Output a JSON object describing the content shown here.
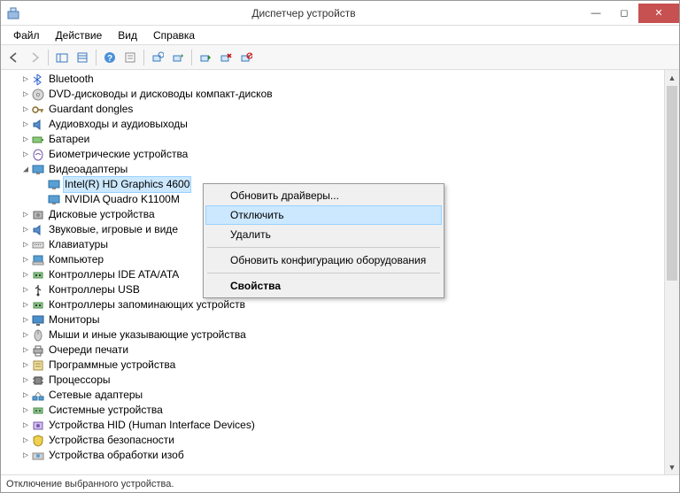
{
  "window": {
    "title": "Диспетчер устройств"
  },
  "menu": {
    "file": "Файл",
    "action": "Действие",
    "view": "Вид",
    "help": "Справка"
  },
  "tree": {
    "nodes": [
      {
        "label": "Bluetooth",
        "expander": "▷",
        "indent": 1,
        "icon": "bluetooth"
      },
      {
        "label": "DVD-дисководы и дисководы компакт-дисков",
        "expander": "▷",
        "indent": 1,
        "icon": "dvd"
      },
      {
        "label": "Guardant dongles",
        "expander": "▷",
        "indent": 1,
        "icon": "key"
      },
      {
        "label": "Аудиовходы и аудиовыходы",
        "expander": "▷",
        "indent": 1,
        "icon": "audio"
      },
      {
        "label": "Батареи",
        "expander": "▷",
        "indent": 1,
        "icon": "battery"
      },
      {
        "label": "Биометрические устройства",
        "expander": "▷",
        "indent": 1,
        "icon": "biometric"
      },
      {
        "label": "Видеоадаптеры",
        "expander": "◢",
        "indent": 1,
        "icon": "display"
      },
      {
        "label": "Intel(R) HD Graphics 4600",
        "expander": "",
        "indent": 2,
        "icon": "display",
        "selected": true
      },
      {
        "label": "NVIDIA Quadro K1100M",
        "expander": "",
        "indent": 2,
        "icon": "display"
      },
      {
        "label": "Дисковые устройства",
        "expander": "▷",
        "indent": 1,
        "icon": "disk"
      },
      {
        "label": "Звуковые, игровые и виде",
        "expander": "▷",
        "indent": 1,
        "icon": "audio"
      },
      {
        "label": "Клавиатуры",
        "expander": "▷",
        "indent": 1,
        "icon": "keyboard"
      },
      {
        "label": "Компьютер",
        "expander": "▷",
        "indent": 1,
        "icon": "computer"
      },
      {
        "label": "Контроллеры IDE ATA/ATA",
        "expander": "▷",
        "indent": 1,
        "icon": "controller"
      },
      {
        "label": "Контроллеры USB",
        "expander": "▷",
        "indent": 1,
        "icon": "usb"
      },
      {
        "label": "Контроллеры запоминающих устройств",
        "expander": "▷",
        "indent": 1,
        "icon": "controller"
      },
      {
        "label": "Мониторы",
        "expander": "▷",
        "indent": 1,
        "icon": "monitor"
      },
      {
        "label": "Мыши и иные указывающие устройства",
        "expander": "▷",
        "indent": 1,
        "icon": "mouse"
      },
      {
        "label": "Очереди печати",
        "expander": "▷",
        "indent": 1,
        "icon": "printer"
      },
      {
        "label": "Программные устройства",
        "expander": "▷",
        "indent": 1,
        "icon": "software"
      },
      {
        "label": "Процессоры",
        "expander": "▷",
        "indent": 1,
        "icon": "cpu"
      },
      {
        "label": "Сетевые адаптеры",
        "expander": "▷",
        "indent": 1,
        "icon": "network"
      },
      {
        "label": "Системные устройства",
        "expander": "▷",
        "indent": 1,
        "icon": "system"
      },
      {
        "label": "Устройства HID (Human Interface Devices)",
        "expander": "▷",
        "indent": 1,
        "icon": "hid"
      },
      {
        "label": "Устройства безопасности",
        "expander": "▷",
        "indent": 1,
        "icon": "security"
      },
      {
        "label": "Устройства обработки изоб",
        "expander": "▷",
        "indent": 1,
        "icon": "imaging"
      }
    ]
  },
  "context_menu": {
    "update_drivers": "Обновить драйверы...",
    "disable": "Отключить",
    "delete": "Удалить",
    "refresh": "Обновить конфигурацию оборудования",
    "properties": "Свойства"
  },
  "statusbar": {
    "text": "Отключение выбранного устройства."
  }
}
